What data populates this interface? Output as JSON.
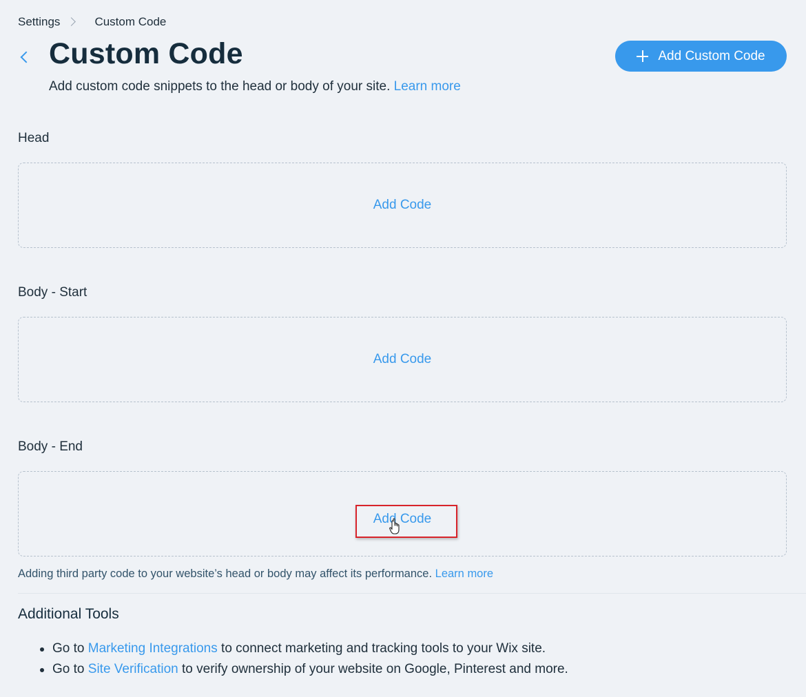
{
  "breadcrumb": {
    "root": "Settings",
    "current": "Custom Code"
  },
  "header": {
    "title": "Custom Code",
    "subtitle": "Add custom code snippets to the head or body of your site.",
    "learn_more": "Learn more",
    "add_button_label": "Add Custom Code"
  },
  "sections": [
    {
      "label": "Head",
      "action": "Add Code"
    },
    {
      "label": "Body - Start",
      "action": "Add Code"
    },
    {
      "label": "Body - End",
      "action": "Add Code"
    }
  ],
  "warning": {
    "text": "Adding third party code to your website’s head or body may affect its performance.",
    "learn_more": "Learn more"
  },
  "tools": {
    "title": "Additional Tools",
    "items": [
      {
        "prefix": "Go to",
        "link": "Marketing Integrations",
        "suffix": "to connect marketing and tracking tools to your Wix site."
      },
      {
        "prefix": "Go to",
        "link": "Site Verification",
        "suffix": "to verify ownership of your website on Google, Pinterest and more."
      }
    ]
  },
  "colors": {
    "accent": "#3899ec",
    "background": "#eff2f6",
    "highlight": "#d8232a"
  }
}
